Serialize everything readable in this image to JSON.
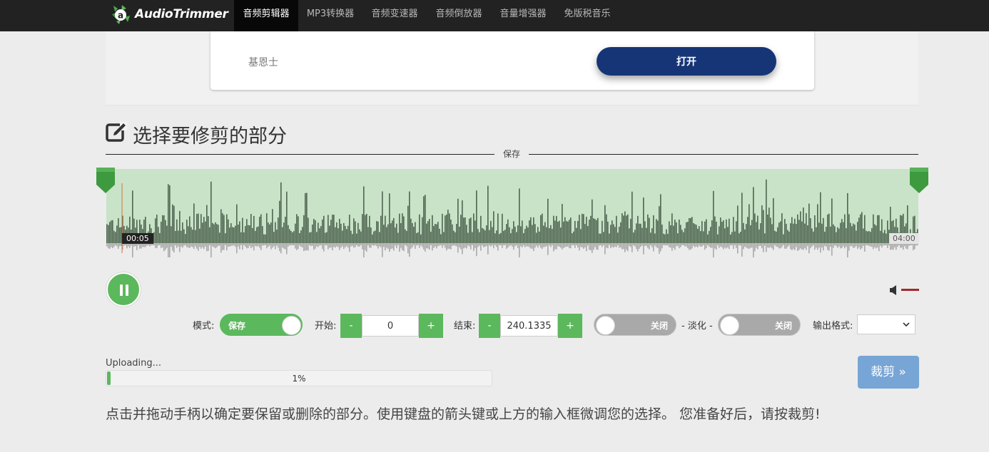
{
  "nav": {
    "brand": "AudioTrimmer",
    "items": [
      {
        "label": "音频剪辑器",
        "active": true
      },
      {
        "label": "MP3转换器",
        "active": false
      },
      {
        "label": "音频变速器",
        "active": false
      },
      {
        "label": "音频倒放器",
        "active": false
      },
      {
        "label": "音量增强器",
        "active": false
      },
      {
        "label": "免版税音乐",
        "active": false
      }
    ]
  },
  "file": {
    "name": "基恩士",
    "open_label": "打开"
  },
  "section": {
    "title": "选择要修剪的部分",
    "mode_divider_label": "保存"
  },
  "waveform": {
    "current_time": "00:05",
    "end_time": "04:00",
    "icons": [
      "edit-icon",
      "start-handle-icon",
      "end-handle-icon",
      "pause-icon",
      "volume-icon"
    ]
  },
  "controls": {
    "mode_label": "模式:",
    "mode_value": "保存",
    "start_label": "开始:",
    "start_value": "0",
    "end_label": "结束:",
    "end_value": "240.1335",
    "minus": "-",
    "plus": "+",
    "fade_in_value": "关闭",
    "fade_label": "- 淡化 -",
    "fade_out_value": "关闭",
    "format_label": "输出格式:",
    "format_value": ""
  },
  "upload": {
    "status": "Uploading...",
    "percent_text": "1%",
    "percent": 1,
    "cut_label": "裁剪 »"
  },
  "instructions": "点击并拖动手柄以确定要保留或删除的部分。使用键盘的箭头键或上方的输入框微调您的选择。 您准备好后，请按裁剪!",
  "colors": {
    "nav_bg": "#222222",
    "accent_green": "#5cb85c",
    "open_button": "#163577",
    "cut_button": "#77a5d5",
    "wave_fill": "#4f6550",
    "wave_bg": "#c6e2c6"
  }
}
